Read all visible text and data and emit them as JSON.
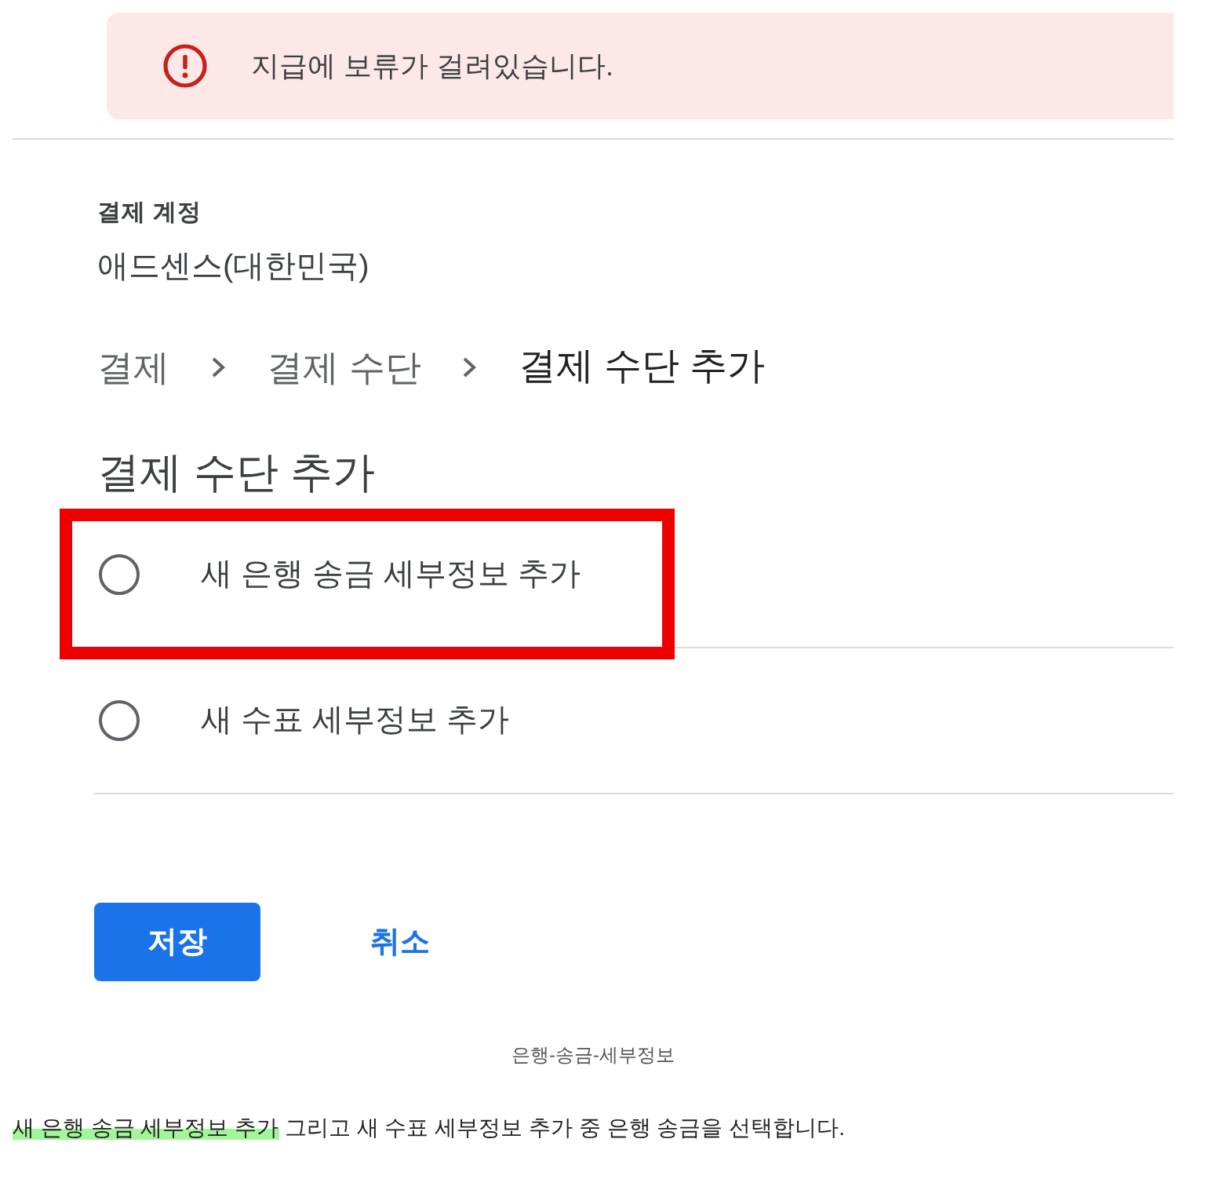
{
  "alert": {
    "message": "지급에 보류가 걸려있습니다."
  },
  "billing_account": {
    "label": "결제 계정",
    "value": "애드센스(대한민국)"
  },
  "breadcrumb": [
    {
      "label": "결제",
      "current": false
    },
    {
      "label": "결제 수단",
      "current": false
    },
    {
      "label": "결제 수단 추가",
      "current": true
    }
  ],
  "heading": "결제 수단 추가",
  "options": [
    {
      "label": "새 은행 송금 세부정보 추가",
      "selected": false,
      "highlighted": true
    },
    {
      "label": "새 수표 세부정보 추가",
      "selected": false,
      "highlighted": false
    }
  ],
  "buttons": [
    {
      "label": "저장",
      "kind": "primary"
    },
    {
      "label": "취소",
      "kind": "text"
    }
  ],
  "caption": "은행-송금-세부정보",
  "paragraph": [
    {
      "text": "새 은행 송금 세부정보 추가",
      "highlighted": true
    },
    {
      "text": " 그리고 새 수표 세부정보 추가 중 은행 송금을 선택합니다.",
      "highlighted": false
    }
  ]
}
